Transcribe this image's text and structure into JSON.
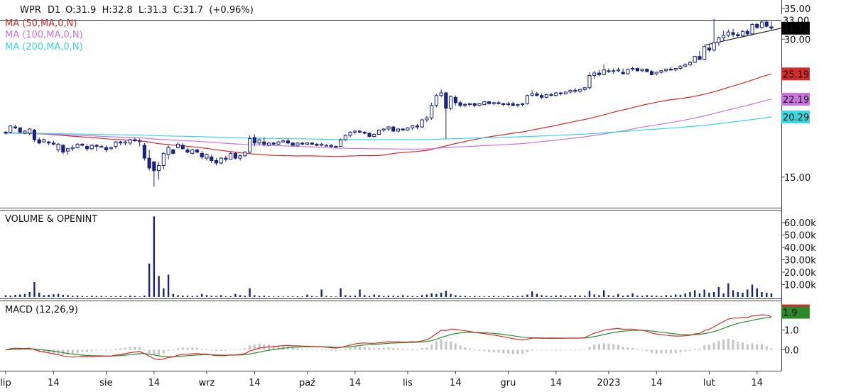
{
  "chart_data": {
    "type": "candlestick",
    "symbol": "WPR",
    "interval": "D1",
    "header": {
      "symbol_label": "WPR",
      "interval_label": "D1",
      "ohlc_text": "O:31.9  H:32.8  L:31.3  C:31.7  (+0.96%)",
      "open": 31.9,
      "high": 32.8,
      "low": 31.3,
      "close": 31.7,
      "change_pct": 0.96
    },
    "indicators": [
      {
        "name": "MA (50,MA,0,N)",
        "color": "#d42b2b",
        "last_value": 25.19,
        "last_label": "25.19"
      },
      {
        "name": "MA (100,MA,0,N)",
        "color": "#c873e0",
        "last_value": 22.19,
        "last_label": "22.19"
      },
      {
        "name": "MA (200,MA,0,N)",
        "color": "#39d6e0",
        "last_value": 20.29,
        "last_label": "20.29"
      }
    ],
    "price_axis": {
      "ticks": [
        15,
        30,
        35
      ],
      "tick_labels": [
        "15.00",
        "30.00",
        "35.00"
      ],
      "scale": "log",
      "ylim": [
        13.0,
        35.5
      ]
    },
    "horizontal_line": {
      "value": 33.0,
      "label": "33.00"
    },
    "last_price": {
      "value": 31.7,
      "label": "31.70",
      "color": "#000000"
    },
    "x_axis": {
      "labels": [
        "lip",
        "14",
        "sie",
        "14",
        "wrz",
        "14",
        "paź",
        "14",
        "lis",
        "14",
        "gru",
        "14",
        "2023",
        "14",
        "lut",
        "14"
      ]
    },
    "candles": [
      [
        18.8,
        18.9,
        18.6,
        18.7
      ],
      [
        18.8,
        19.5,
        18.7,
        19.4
      ],
      [
        19.3,
        19.5,
        19.1,
        19.2
      ],
      [
        19.2,
        19.3,
        18.7,
        18.8
      ],
      [
        18.7,
        19.0,
        18.6,
        18.9
      ],
      [
        18.7,
        19.2,
        18.5,
        19.1
      ],
      [
        19.0,
        19.1,
        17.9,
        18.1
      ],
      [
        18.1,
        18.3,
        17.7,
        17.8
      ],
      [
        17.9,
        18.2,
        17.8,
        18.1
      ],
      [
        17.9,
        18.0,
        17.6,
        17.8
      ],
      [
        17.8,
        18.0,
        17.6,
        17.7
      ],
      [
        17.2,
        17.8,
        17.0,
        17.7
      ],
      [
        17.6,
        17.7,
        16.8,
        17.0
      ],
      [
        17.1,
        17.4,
        16.8,
        17.3
      ],
      [
        17.3,
        17.6,
        17.1,
        17.4
      ],
      [
        17.4,
        17.8,
        17.3,
        17.7
      ],
      [
        17.7,
        17.8,
        17.5,
        17.6
      ],
      [
        17.5,
        17.7,
        17.1,
        17.3
      ],
      [
        17.3,
        17.7,
        17.2,
        17.6
      ],
      [
        17.6,
        17.7,
        17.1,
        17.5
      ],
      [
        17.5,
        17.6,
        17.4,
        17.5
      ],
      [
        17.4,
        17.6,
        17.0,
        17.2
      ],
      [
        17.3,
        17.5,
        17.2,
        17.4
      ],
      [
        17.5,
        18.0,
        17.3,
        17.9
      ],
      [
        17.9,
        18.0,
        17.6,
        17.8
      ],
      [
        17.8,
        18.0,
        17.6,
        17.9
      ],
      [
        17.8,
        18.2,
        17.6,
        18.1
      ],
      [
        18.1,
        18.3,
        17.9,
        18.0
      ],
      [
        18.0,
        18.2,
        17.5,
        18.0
      ],
      [
        17.6,
        17.8,
        16.3,
        16.5
      ],
      [
        16.5,
        17.2,
        15.5,
        15.7
      ],
      [
        16.2,
        16.2,
        14.3,
        15.5
      ],
      [
        15.5,
        16.2,
        14.8,
        15.9
      ],
      [
        15.9,
        17.0,
        15.6,
        16.9
      ],
      [
        16.8,
        17.6,
        16.4,
        17.4
      ],
      [
        17.2,
        17.3,
        16.8,
        16.9
      ],
      [
        17.4,
        17.9,
        17.3,
        17.7
      ],
      [
        17.6,
        17.8,
        17.2,
        17.3
      ],
      [
        17.2,
        17.4,
        16.9,
        17.0
      ],
      [
        16.9,
        17.3,
        16.8,
        17.2
      ],
      [
        17.2,
        17.3,
        16.9,
        17.0
      ],
      [
        16.9,
        17.1,
        16.4,
        16.6
      ],
      [
        16.5,
        16.9,
        16.3,
        16.8
      ],
      [
        16.6,
        16.8,
        16.1,
        16.3
      ],
      [
        16.3,
        16.5,
        15.9,
        16.1
      ],
      [
        16.1,
        16.6,
        16.0,
        16.5
      ],
      [
        16.5,
        16.7,
        16.2,
        16.4
      ],
      [
        16.4,
        17.0,
        16.4,
        16.9
      ],
      [
        16.9,
        17.0,
        16.4,
        16.5
      ],
      [
        16.5,
        16.8,
        16.3,
        16.7
      ],
      [
        16.7,
        17.1,
        16.6,
        17.0
      ],
      [
        17.0,
        18.5,
        16.9,
        18.2
      ],
      [
        18.3,
        18.6,
        17.5,
        17.8
      ],
      [
        17.8,
        18.2,
        17.6,
        18.1
      ],
      [
        17.9,
        18.3,
        17.5,
        17.7
      ],
      [
        17.6,
        17.9,
        17.5,
        17.8
      ],
      [
        17.8,
        17.9,
        17.6,
        17.7
      ],
      [
        17.7,
        18.0,
        17.6,
        17.9
      ],
      [
        17.9,
        18.1,
        17.8,
        18.0
      ],
      [
        18.0,
        18.2,
        17.7,
        17.8
      ],
      [
        17.8,
        17.9,
        17.5,
        17.6
      ],
      [
        17.6,
        17.9,
        17.5,
        17.8
      ],
      [
        17.8,
        17.9,
        17.6,
        17.7
      ],
      [
        17.7,
        17.9,
        17.6,
        17.8
      ],
      [
        17.8,
        17.9,
        17.6,
        17.7
      ],
      [
        17.7,
        17.8,
        17.5,
        17.6
      ],
      [
        17.6,
        17.8,
        17.5,
        17.7
      ],
      [
        17.6,
        17.7,
        17.5,
        17.6
      ],
      [
        17.6,
        17.7,
        17.4,
        17.5
      ],
      [
        17.5,
        17.6,
        17.4,
        17.5
      ],
      [
        17.5,
        18.2,
        17.5,
        18.1
      ],
      [
        18.1,
        18.6,
        18.0,
        18.5
      ],
      [
        18.5,
        18.9,
        18.3,
        18.8
      ],
      [
        18.8,
        19.0,
        18.6,
        18.9
      ],
      [
        18.9,
        19.0,
        18.7,
        18.8
      ],
      [
        18.8,
        18.9,
        18.6,
        18.7
      ],
      [
        18.7,
        18.8,
        18.3,
        18.4
      ],
      [
        18.4,
        18.7,
        18.3,
        18.6
      ],
      [
        18.6,
        19.1,
        18.5,
        19.0
      ],
      [
        19.0,
        19.2,
        18.8,
        19.1
      ],
      [
        19.1,
        19.4,
        18.9,
        19.3
      ],
      [
        19.3,
        19.4,
        18.8,
        18.9
      ],
      [
        18.9,
        19.2,
        18.8,
        19.1
      ],
      [
        19.1,
        19.2,
        18.9,
        19.0
      ],
      [
        19.0,
        19.3,
        18.9,
        19.2
      ],
      [
        19.2,
        19.5,
        19.0,
        19.4
      ],
      [
        19.4,
        19.6,
        19.1,
        19.3
      ],
      [
        19.3,
        20.1,
        19.2,
        20.0
      ],
      [
        20.0,
        20.4,
        19.8,
        20.2
      ],
      [
        20.2,
        21.8,
        20.0,
        21.5
      ],
      [
        21.5,
        22.8,
        21.3,
        22.6
      ],
      [
        22.6,
        23.3,
        22.4,
        22.9
      ],
      [
        22.9,
        23.0,
        18.2,
        21.2
      ],
      [
        21.2,
        22.6,
        21.0,
        22.5
      ],
      [
        22.4,
        22.6,
        21.5,
        21.8
      ],
      [
        21.8,
        22.0,
        21.3,
        21.5
      ],
      [
        21.5,
        21.8,
        21.3,
        21.6
      ],
      [
        21.6,
        21.8,
        21.4,
        21.7
      ],
      [
        21.7,
        21.8,
        21.3,
        21.5
      ],
      [
        21.5,
        21.8,
        21.4,
        21.7
      ],
      [
        21.6,
        22.0,
        21.5,
        21.9
      ],
      [
        21.9,
        22.0,
        21.6,
        21.7
      ],
      [
        21.7,
        21.9,
        21.5,
        21.8
      ],
      [
        21.8,
        22.0,
        21.6,
        21.7
      ],
      [
        21.7,
        21.8,
        21.4,
        21.6
      ],
      [
        21.6,
        21.9,
        21.4,
        21.7
      ],
      [
        21.7,
        21.9,
        21.4,
        21.5
      ],
      [
        21.5,
        21.7,
        21.3,
        21.6
      ],
      [
        21.6,
        21.8,
        21.4,
        21.7
      ],
      [
        21.7,
        22.7,
        21.6,
        22.6
      ],
      [
        22.6,
        23.2,
        22.5,
        22.8
      ],
      [
        22.8,
        23.0,
        22.5,
        22.6
      ],
      [
        22.6,
        22.8,
        22.2,
        22.4
      ],
      [
        22.4,
        22.8,
        22.3,
        22.7
      ],
      [
        22.7,
        22.9,
        22.5,
        22.6
      ],
      [
        22.6,
        23.0,
        22.5,
        22.9
      ],
      [
        22.9,
        23.0,
        22.6,
        22.8
      ],
      [
        22.8,
        23.1,
        22.7,
        23.0
      ],
      [
        23.0,
        23.3,
        22.8,
        23.2
      ],
      [
        23.2,
        23.5,
        22.9,
        23.1
      ],
      [
        23.1,
        23.4,
        22.9,
        23.3
      ],
      [
        23.3,
        23.6,
        23.1,
        23.5
      ],
      [
        23.5,
        25.4,
        23.3,
        25.0
      ],
      [
        25.0,
        25.6,
        24.6,
        25.3
      ],
      [
        25.3,
        25.7,
        24.9,
        25.1
      ],
      [
        25.1,
        26.4,
        25.0,
        25.7
      ],
      [
        25.6,
        25.9,
        25.3,
        25.5
      ],
      [
        25.5,
        25.9,
        25.2,
        25.6
      ],
      [
        25.6,
        26.0,
        25.4,
        25.7
      ],
      [
        25.4,
        25.9,
        25.1,
        25.2
      ],
      [
        25.2,
        25.9,
        25.1,
        25.8
      ],
      [
        25.8,
        26.1,
        25.6,
        25.9
      ],
      [
        25.9,
        26.0,
        25.5,
        25.6
      ],
      [
        25.6,
        25.9,
        25.4,
        25.8
      ],
      [
        25.8,
        25.9,
        25.4,
        25.5
      ],
      [
        25.5,
        25.7,
        25.0,
        25.1
      ],
      [
        25.2,
        25.5,
        25.0,
        25.4
      ],
      [
        25.4,
        25.7,
        25.2,
        25.6
      ],
      [
        25.6,
        25.9,
        25.4,
        25.8
      ],
      [
        25.8,
        26.1,
        25.6,
        25.7
      ],
      [
        25.7,
        26.0,
        25.5,
        25.9
      ],
      [
        25.9,
        26.3,
        25.7,
        26.2
      ],
      [
        26.2,
        26.6,
        26.0,
        26.4
      ],
      [
        26.4,
        26.9,
        26.2,
        26.7
      ],
      [
        26.7,
        27.6,
        26.6,
        27.5
      ],
      [
        27.5,
        28.3,
        27.0,
        27.1
      ],
      [
        27.1,
        29.0,
        27.0,
        28.9
      ],
      [
        28.7,
        29.3,
        28.1,
        28.4
      ],
      [
        28.4,
        33.2,
        28.2,
        29.5
      ],
      [
        29.5,
        30.4,
        29.0,
        30.2
      ],
      [
        30.2,
        31.3,
        29.8,
        30.6
      ],
      [
        30.6,
        31.5,
        30.3,
        31.1
      ],
      [
        31.0,
        31.6,
        30.3,
        30.7
      ],
      [
        30.7,
        31.1,
        30.2,
        30.5
      ],
      [
        30.5,
        31.4,
        30.4,
        31.2
      ],
      [
        31.2,
        31.5,
        30.6,
        30.8
      ],
      [
        30.8,
        32.5,
        30.7,
        32.3
      ],
      [
        32.3,
        32.6,
        31.6,
        31.8
      ],
      [
        31.8,
        32.9,
        31.6,
        32.7
      ],
      [
        32.7,
        33.1,
        31.8,
        32.0
      ],
      [
        31.9,
        32.8,
        31.3,
        31.7
      ]
    ],
    "volume_pane": {
      "title": "VOLUME & OPENINT",
      "units": "thousands",
      "tick_labels": [
        "10.00k",
        "20.00k",
        "30.00k",
        "40.00k",
        "50.00k",
        "60.00k"
      ],
      "ticks": [
        10,
        20,
        30,
        40,
        50,
        60
      ],
      "ylim": [
        0,
        68
      ]
    },
    "volumes": [
      1.5,
      1.2,
      1.8,
      2.0,
      2.5,
      4.0,
      12.0,
      3.5,
      1.5,
      1.8,
      2.2,
      2.5,
      1.8,
      1.5,
      1.0,
      1.2,
      0.8,
      0.6,
      1.0,
      0.8,
      0.8,
      0.5,
      0.6,
      0.6,
      0.8,
      0.5,
      1.0,
      0.8,
      0.4,
      1.2,
      27.0,
      65.0,
      17.0,
      7.0,
      18.0,
      2.5,
      1.5,
      1.2,
      1.0,
      0.8,
      1.0,
      2.5,
      1.5,
      1.0,
      0.8,
      1.5,
      0.6,
      0.6,
      2.5,
      1.5,
      1.0,
      7.0,
      1.5,
      0.8,
      1.0,
      0.6,
      0.4,
      0.5,
      0.4,
      0.5,
      0.5,
      0.6,
      0.5,
      2.0,
      0.8,
      0.5,
      6.0,
      0.8,
      0.5,
      0.4,
      7.0,
      1.5,
      1.0,
      1.2,
      6.0,
      1.5,
      0.8,
      2.0,
      1.5,
      0.8,
      1.2,
      1.0,
      0.8,
      1.5,
      1.0,
      0.8,
      0.6,
      1.5,
      2.0,
      3.0,
      2.5,
      3.5,
      5.0,
      2.5,
      1.5,
      1.0,
      0.8,
      0.6,
      0.8,
      0.5,
      0.5,
      0.6,
      0.8,
      0.6,
      0.5,
      1.0,
      0.6,
      0.8,
      1.0,
      2.0,
      4.5,
      2.5,
      1.5,
      1.0,
      0.8,
      1.2,
      1.5,
      0.8,
      1.0,
      1.5,
      1.2,
      1.0,
      5.0,
      2.0,
      1.5,
      5.5,
      1.5,
      1.0,
      2.5,
      1.0,
      1.5,
      3.0,
      1.2,
      1.0,
      1.5,
      1.2,
      1.0,
      0.8,
      1.5,
      1.2,
      2.0,
      1.8,
      3.0,
      4.0,
      5.5,
      3.0,
      6.0,
      3.5,
      4.0,
      8.0,
      3.0,
      11.0,
      5.5,
      4.0,
      3.5,
      6.0,
      10.0,
      7.0,
      4.0,
      3.5,
      3.0
    ],
    "macd_pane": {
      "title": "MACD (12,26,9)",
      "tick_labels": [
        "0.0",
        "1.0"
      ],
      "ticks": [
        0.0,
        1.0
      ],
      "ylim": [
        -0.95,
        2.35
      ],
      "last_label": "1.9",
      "last_value": 1.9,
      "line_color": "#d42b2b",
      "signal_color": "#2a8a2a",
      "histogram_color": "#c4c4c4"
    }
  }
}
